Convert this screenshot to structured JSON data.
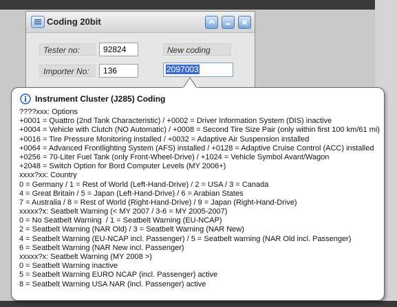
{
  "window": {
    "title": "Coding 20bit",
    "app_icon": "window-list-icon",
    "controls": [
      "chevron-up-icon",
      "minimize-icon",
      "close-icon"
    ]
  },
  "form": {
    "tester_label": "Tester no:",
    "tester_value": "92824",
    "importer_label": "Importer No:",
    "importer_value": "136",
    "new_coding_label": "New coding",
    "coding_value": "2097003"
  },
  "tooltip": {
    "icon": "info-icon",
    "title": "Instrument Cluster (J285) Coding",
    "lines": [
      "????xxx: Options",
      "+0001 = Quattro (2nd Tank Characteristic) / +0002 = Driver Information System (DIS) inactive",
      "+0004 = Vehicle with Clutch (NO Automatic) / +0008 = Second Tire Size Pair (only within first 100 km/61 mi)",
      "+0016 = Tire Pressure Monitoring installed / +0032 = Adaptive Air Suspension installed",
      "+0064 = Advanced Frontlighting System (AFS) installed / +0128 = Adaptive Cruise Control (ACC) installed",
      "+0256 = 70-Liter Fuel Tank (only Front-Wheel-Drive) / +1024 = Vehicle Symbol Avant/Wagon",
      "+2048 = Switch Option for Bord Computer Levels (MY 2006+)",
      "xxxx?xx: Country",
      "0 = Germany / 1 = Rest of World (Left-Hand-Drive) / 2 = USA / 3 = Canada",
      "4 = Great Britain / 5 = Japan (Left-Hand-Drive) / 6 = Arabian States",
      "7 = Australia / 8 = Rest of World (Right-Hand-Drive) / 9 = Japan (Right-Hand-Drive)",
      "xxxxx?x: Seatbelt Warning (< MY 2007 / 3-6 = MY 2005-2007)",
      "0 = No Seatbelt Warning  / 1 = Seatbelt Warning (EU-NCAP)",
      "2 = Seatbelt Warning (NAR Old) / 3 = Seatbelt Warning (NAR New)",
      "4 = Seatbelt Warning (EU-NCAP incl. Passenger) / 5 = Seatbelt warning (NAR Old incl. Passenger)",
      "6 = Seatbelt Warning (NAR New incl. Passenger)",
      "xxxxx?x: Seatbelt Warning (MY 2008 >)",
      "0 = Seatbelt Warning inactive",
      "5 = Seatbelt Warning EURO NCAP (incl. Passenger) active",
      "8 = Seatbelt Warning USA NAR (incl. Passenger) active"
    ]
  }
}
